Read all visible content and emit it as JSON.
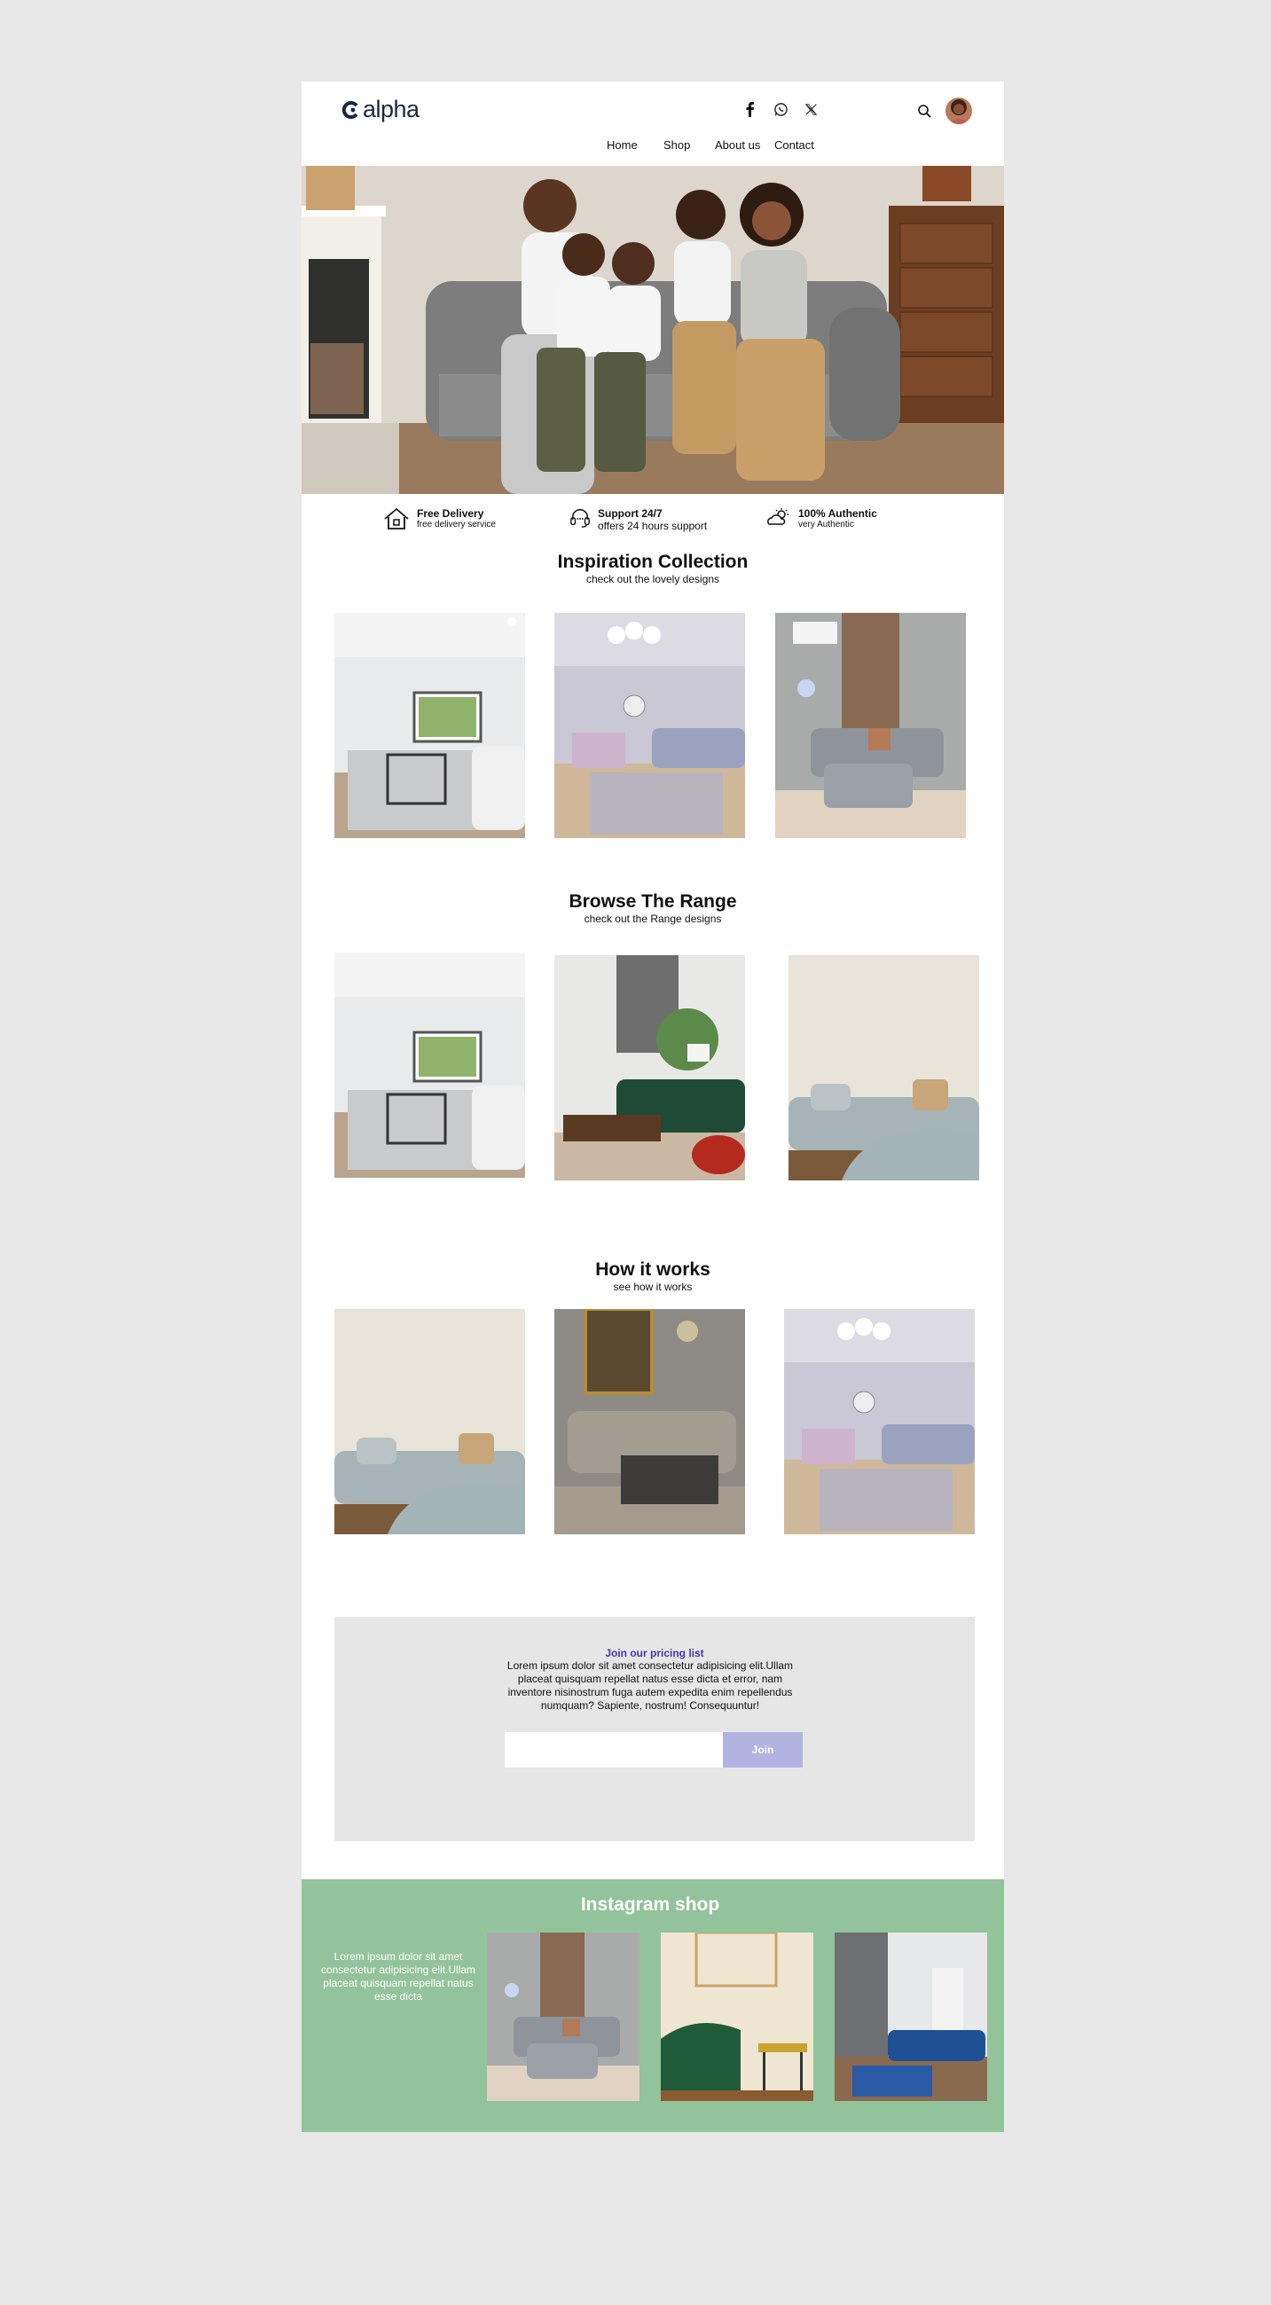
{
  "header": {
    "logo_text": "alpha",
    "social": [
      "facebook-icon",
      "whatsapp-icon",
      "x-icon"
    ],
    "nav": [
      "Home",
      "Shop",
      "About us",
      "Contact"
    ]
  },
  "features": [
    {
      "title": "Free Delivery",
      "subtitle": "free delivery service",
      "icon": "house-icon"
    },
    {
      "title": "Support 24/7",
      "subtitle": "offers 24 hours support",
      "icon": "headset-icon"
    },
    {
      "title": "100% Authentic",
      "subtitle": "very Authentic",
      "icon": "sun-cloud-icon"
    }
  ],
  "inspiration": {
    "title": "Inspiration Collection",
    "subtitle": "check out the lovely designs"
  },
  "range": {
    "title": "Browse The Range",
    "subtitle": "check out the Range designs"
  },
  "how": {
    "title": "How it works",
    "subtitle": "see how it works"
  },
  "pricing": {
    "title": "Join our pricing list",
    "body": "Lorem ipsum dolor sit amet consectetur adipisicing elit.Ullam placeat quisquam repellat natus esse dicta et error, nam inventore nisinostrum fuga autem expedita enim repellendus numquam? Sapiente, nostrum! Consequuntur!",
    "input_placeholder": "",
    "button": "Join"
  },
  "instagram": {
    "title": "Instagram shop",
    "text": "Lorem ipsum dolor sit amet consectetur adipisicing elit.Ullam placeat quisquam repellat natus esse dicta"
  },
  "colors": {
    "accent": "#4a35a8",
    "button": "#b3b3e2",
    "instagram_bg": "#93c39a",
    "page_bg": "#e8e8e8"
  }
}
